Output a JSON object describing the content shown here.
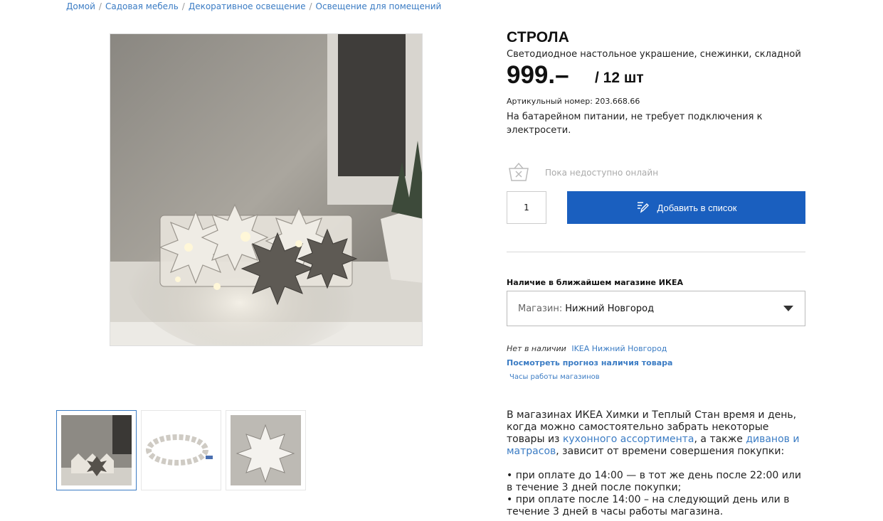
{
  "breadcrumb": [
    "Домой",
    "Садовая мебель",
    "Декоративное освещение",
    "Освещение для помещений"
  ],
  "product": {
    "name": "СТРОЛА",
    "subtitle": "Светодиодное настольное украшение, снежинки, складной",
    "price": "999.–",
    "unit": "/ 12 шт",
    "article": "Артикульный номер: 203.668.66",
    "description": "На батарейном питании, не требует подключения к электросети."
  },
  "availability": {
    "online_status": "Пока недоступно онлайн",
    "quantity": "1",
    "add_button": "Добавить в список"
  },
  "store": {
    "heading": "Наличие в ближайшем магазине ИКЕА",
    "select_label": "Магазин:",
    "select_value": "Нижний Новгород",
    "stock_status": "Нет в наличии",
    "stock_store": "IKEA Нижний Новгород",
    "forecast_link": "Посмотреть прогноз наличия товара",
    "hours_link": "Часы работы магазинов"
  },
  "info": {
    "p1_a": "В магазинах ИКЕА Химки и Теплый Стан время и день, когда можно самостоятельно забрать некоторые товары из ",
    "p1_link1": "кухонного ассортимента",
    "p1_b": ", а также ",
    "p1_link2": "диванов и матрасов",
    "p1_c": ", зависит от времени совершения покупки:",
    "b1": "• при оплате до 14:00 — в тот же день после 22:00 или в течение 3 дней после покупки;",
    "b2": "• при оплате после 14:00 – на следующий день или в течение 3 дней в часы работы магазина."
  },
  "colors": {
    "link": "#3b7cc4",
    "button": "#1a5fbf"
  }
}
